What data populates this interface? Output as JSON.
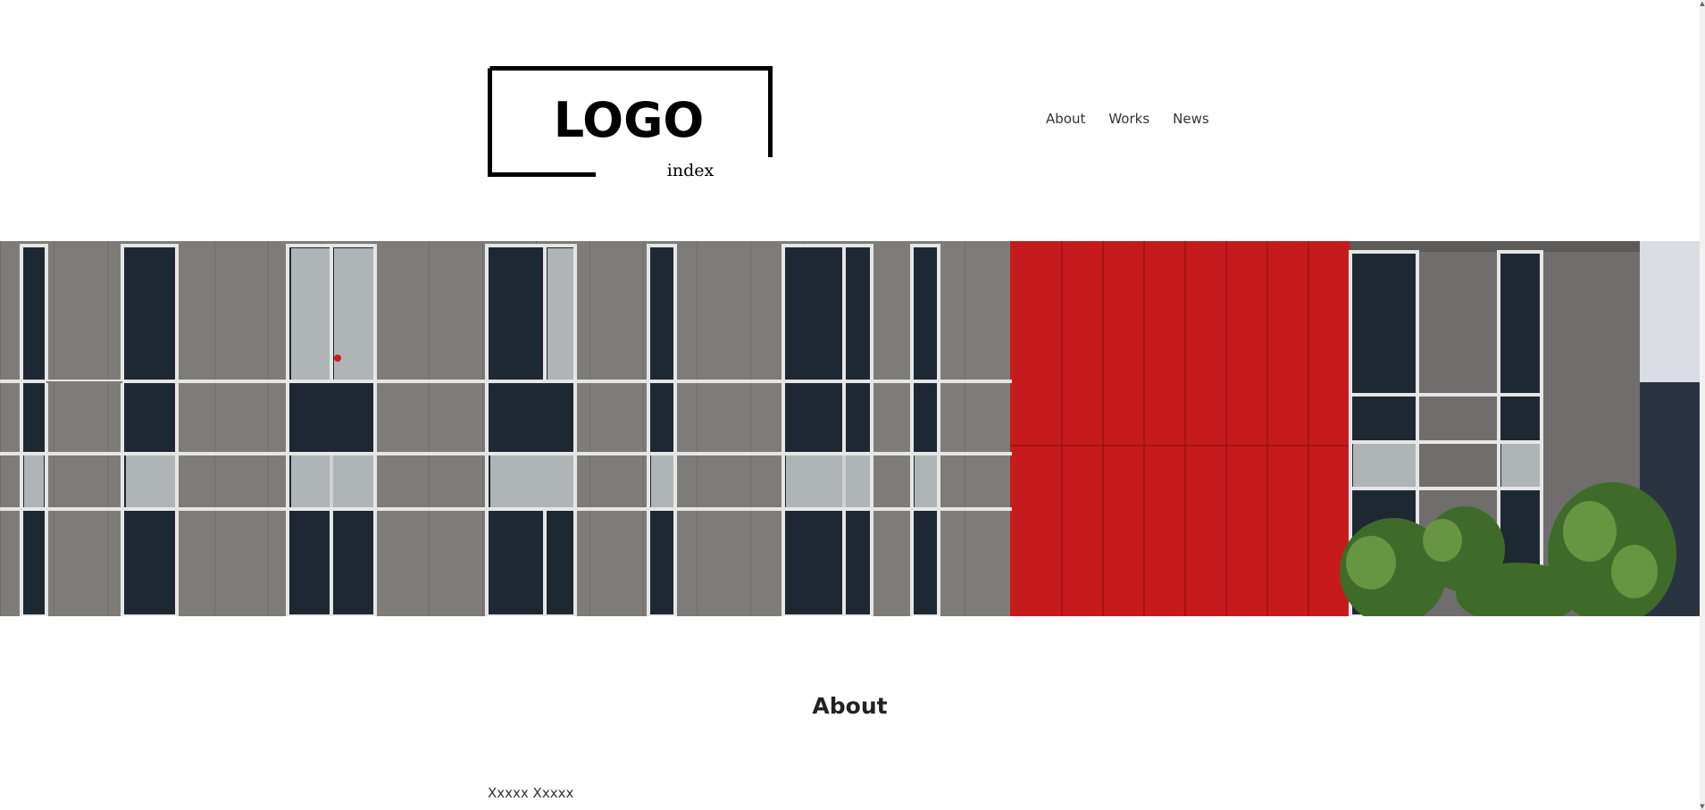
{
  "header": {
    "logo_text": "LOGO",
    "logo_sub": "index",
    "nav": [
      {
        "label": "About"
      },
      {
        "label": "Works"
      },
      {
        "label": "News"
      }
    ]
  },
  "hero": {
    "icon": "building-facade-photo",
    "accent_color": "#cc1c1e"
  },
  "about": {
    "title": "About",
    "text": "Xxxxx Xxxxx"
  }
}
